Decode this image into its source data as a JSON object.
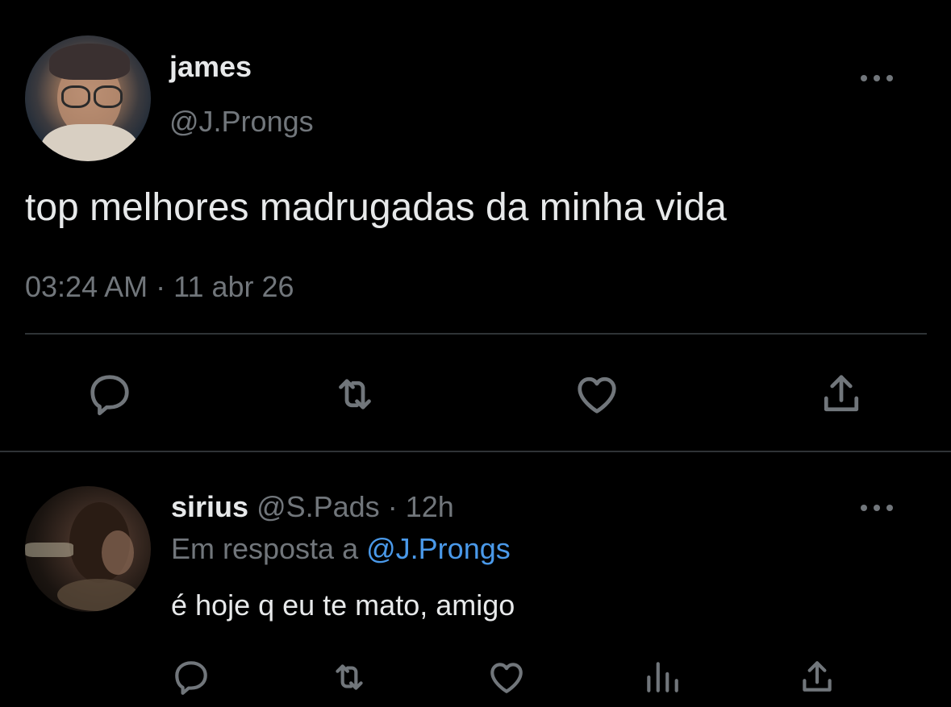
{
  "tweet": {
    "author_name": "james",
    "author_handle": "@J.Prongs",
    "text": "top melhores madrugadas da minha vida",
    "timestamp": "03:24 AM · 11 abr 26",
    "actions": [
      "reply-icon",
      "retweet-icon",
      "like-icon",
      "share-icon"
    ]
  },
  "reply": {
    "author_name": "sirius",
    "author_handle": "@S.Pads",
    "separator": "·",
    "time": "12h",
    "reply_prefix": "Em resposta a",
    "reply_to": "@J.Prongs",
    "text": "é hoje q eu te mato, amigo",
    "actions": [
      "reply-icon",
      "retweet-icon",
      "like-icon",
      "analytics-icon",
      "share-icon"
    ]
  },
  "colors": {
    "background": "#000000",
    "text": "#e7e9ea",
    "muted": "#71767b",
    "link": "#4a99e9",
    "divider": "#2f3336"
  }
}
